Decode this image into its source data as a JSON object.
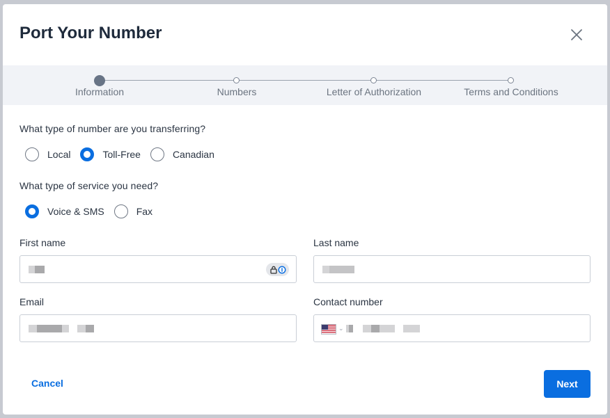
{
  "dialog": {
    "title": "Port Your Number"
  },
  "stepper": {
    "steps": [
      {
        "label": "Information",
        "active": true
      },
      {
        "label": "Numbers",
        "active": false
      },
      {
        "label": "Letter of Authorization",
        "active": false
      },
      {
        "label": "Terms and Conditions",
        "active": false
      }
    ]
  },
  "number_type": {
    "question": "What type of number are you transferring?",
    "options": [
      "Local",
      "Toll-Free",
      "Canadian"
    ],
    "selected": "Toll-Free"
  },
  "service_type": {
    "question": "What type of service you need?",
    "options": [
      "Voice & SMS",
      "Fax"
    ],
    "selected": "Voice & SMS"
  },
  "fields": {
    "first_name_label": "First name",
    "last_name_label": "Last name",
    "email_label": "Email",
    "contact_label": "Contact number"
  },
  "footer": {
    "cancel_label": "Cancel",
    "next_label": "Next"
  },
  "colors": {
    "accent": "#0a6ee0",
    "title": "#1e2a3b",
    "stepper_bg": "#f1f3f7"
  }
}
